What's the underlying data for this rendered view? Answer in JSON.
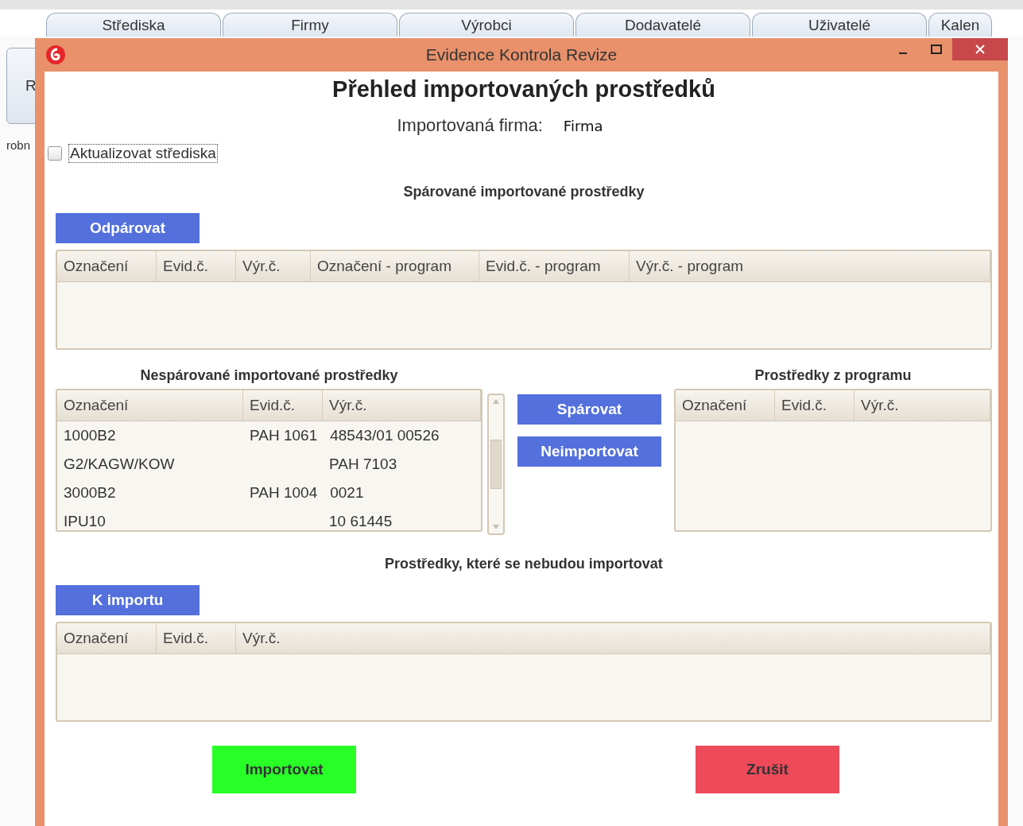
{
  "background": {
    "tabs": [
      "Střediska",
      "Firmy",
      "Výrobci",
      "Dodavatelé",
      "Uživatelé",
      "Kalen"
    ],
    "side_button": "R",
    "side_label": "robn"
  },
  "window": {
    "title": "Evidence Kontrola Revize"
  },
  "heading": "Přehled importovaných prostředků",
  "imported_company": {
    "label": "Importovaná firma:",
    "value": "Firma"
  },
  "update_centers": {
    "label": "Aktualizovat střediska",
    "checked": false
  },
  "paired": {
    "title": "Spárované importované prostředky",
    "button": "Odpárovat",
    "columns": [
      "Označení",
      "Evid.č.",
      "Výr.č.",
      "Označení - program",
      "Evid.č. - program",
      "Výr.č. - program"
    ]
  },
  "unpaired": {
    "title": "Nespárované importované prostředky",
    "columns": [
      "Označení",
      "Evid.č.",
      "Výr.č."
    ],
    "rows": [
      [
        "1000B2",
        "PAH 1061",
        "48543/01 00526"
      ],
      [
        "G2/KAGW/KOW",
        "",
        "PAH 7103"
      ],
      [
        "3000B2",
        "PAH 1004",
        "0021"
      ],
      [
        "IPU10",
        "",
        "10 61445"
      ]
    ]
  },
  "actions": [
    "Spárovat",
    "Neimportovat"
  ],
  "program": {
    "title": "Prostředky z programu",
    "columns": [
      "Označení",
      "Evid.č.",
      "Výr.č."
    ]
  },
  "excluded": {
    "title": "Prostředky, které se nebudou importovat",
    "button": "K importu",
    "columns": [
      "Označení",
      "Evid.č.",
      "Výr.č."
    ]
  },
  "footer_buttons": [
    {
      "label": "Importovat",
      "kind": "confirm"
    },
    {
      "label": "Zrušit",
      "kind": "cancel"
    }
  ]
}
